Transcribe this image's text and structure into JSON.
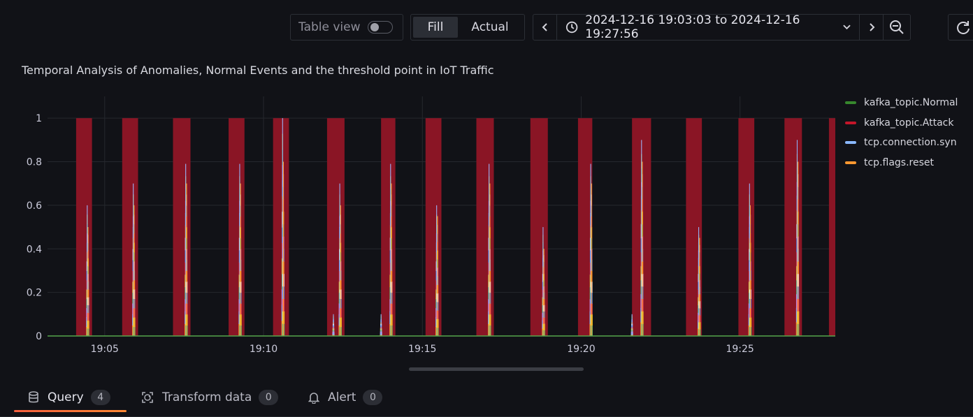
{
  "toolbar": {
    "table_view_label": "Table view",
    "fill_label": "Fill",
    "actual_label": "Actual",
    "time_range": "2024-12-16 19:03:03 to 2024-12-16 19:27:56"
  },
  "panel": {
    "title": "Temporal Analysis of Anomalies, Normal Events and the threshold point in IoT Traffic"
  },
  "chart_data": {
    "type": "bar",
    "title": "Temporal Analysis of Anomalies, Normal Events and the threshold point in IoT Traffic",
    "xlabel": "",
    "ylabel": "",
    "x_ticks": [
      "19:05",
      "19:10",
      "19:15",
      "19:20",
      "19:25"
    ],
    "x_tick_values": [
      5,
      10,
      15,
      20,
      25
    ],
    "y_ticks": [
      "0",
      "0.2",
      "0.4",
      "0.6",
      "0.8",
      "1"
    ],
    "y_tick_values": [
      0,
      0.2,
      0.4,
      0.6,
      0.8,
      1
    ],
    "xlim": [
      3.2,
      28.0
    ],
    "ylim": [
      0,
      1.1
    ],
    "x_unit": "minutes after 19:00",
    "legend_position": "right",
    "grid": true,
    "series": [
      {
        "name": "kafka_topic.Normal",
        "color": "#37872d",
        "kind": "line",
        "values": [
          [
            3.2,
            0
          ],
          [
            28.0,
            0
          ]
        ]
      },
      {
        "name": "kafka_topic.Attack",
        "color": "#c4162a",
        "kind": "bands",
        "value": 1,
        "intervals": [
          [
            4.1,
            4.6
          ],
          [
            5.55,
            6.05
          ],
          [
            7.15,
            7.7
          ],
          [
            8.9,
            9.4
          ],
          [
            10.3,
            10.8
          ],
          [
            12.0,
            12.55
          ],
          [
            13.7,
            14.15
          ],
          [
            15.1,
            15.6
          ],
          [
            16.7,
            17.25
          ],
          [
            18.4,
            18.95
          ],
          [
            19.9,
            20.35
          ],
          [
            21.6,
            22.2
          ],
          [
            23.3,
            23.8
          ],
          [
            24.95,
            25.45
          ],
          [
            26.4,
            26.95
          ],
          [
            27.8,
            28.0
          ]
        ]
      },
      {
        "name": "tcp.connection.syn",
        "color": "#8ab8ff",
        "kind": "spikes",
        "values": [
          [
            4.45,
            0.6
          ],
          [
            5.9,
            0.7
          ],
          [
            7.55,
            0.79
          ],
          [
            9.25,
            0.79
          ],
          [
            10.6,
            1.0
          ],
          [
            12.2,
            0.1
          ],
          [
            12.4,
            0.7
          ],
          [
            13.7,
            0.1
          ],
          [
            14.0,
            0.79
          ],
          [
            15.45,
            0.6
          ],
          [
            17.1,
            0.79
          ],
          [
            18.8,
            0.5
          ],
          [
            20.3,
            0.79
          ],
          [
            21.6,
            0.1
          ],
          [
            21.9,
            0.9
          ],
          [
            23.7,
            0.5
          ],
          [
            25.3,
            0.7
          ],
          [
            26.8,
            0.9
          ]
        ]
      },
      {
        "name": "tcp.flags.reset",
        "color": "#ff9830",
        "kind": "spikes",
        "values": [
          [
            4.45,
            0.5
          ],
          [
            5.9,
            0.6
          ],
          [
            7.55,
            0.7
          ],
          [
            9.25,
            0.7
          ],
          [
            10.6,
            0.8
          ],
          [
            12.4,
            0.6
          ],
          [
            14.0,
            0.7
          ],
          [
            15.45,
            0.55
          ],
          [
            17.1,
            0.7
          ],
          [
            18.8,
            0.4
          ],
          [
            20.3,
            0.7
          ],
          [
            21.9,
            0.8
          ],
          [
            23.7,
            0.45
          ],
          [
            25.3,
            0.6
          ],
          [
            26.8,
            0.8
          ]
        ]
      }
    ]
  },
  "tabs": [
    {
      "label": "Query",
      "count": "4"
    },
    {
      "label": "Transform data",
      "count": "0"
    },
    {
      "label": "Alert",
      "count": "0"
    }
  ]
}
